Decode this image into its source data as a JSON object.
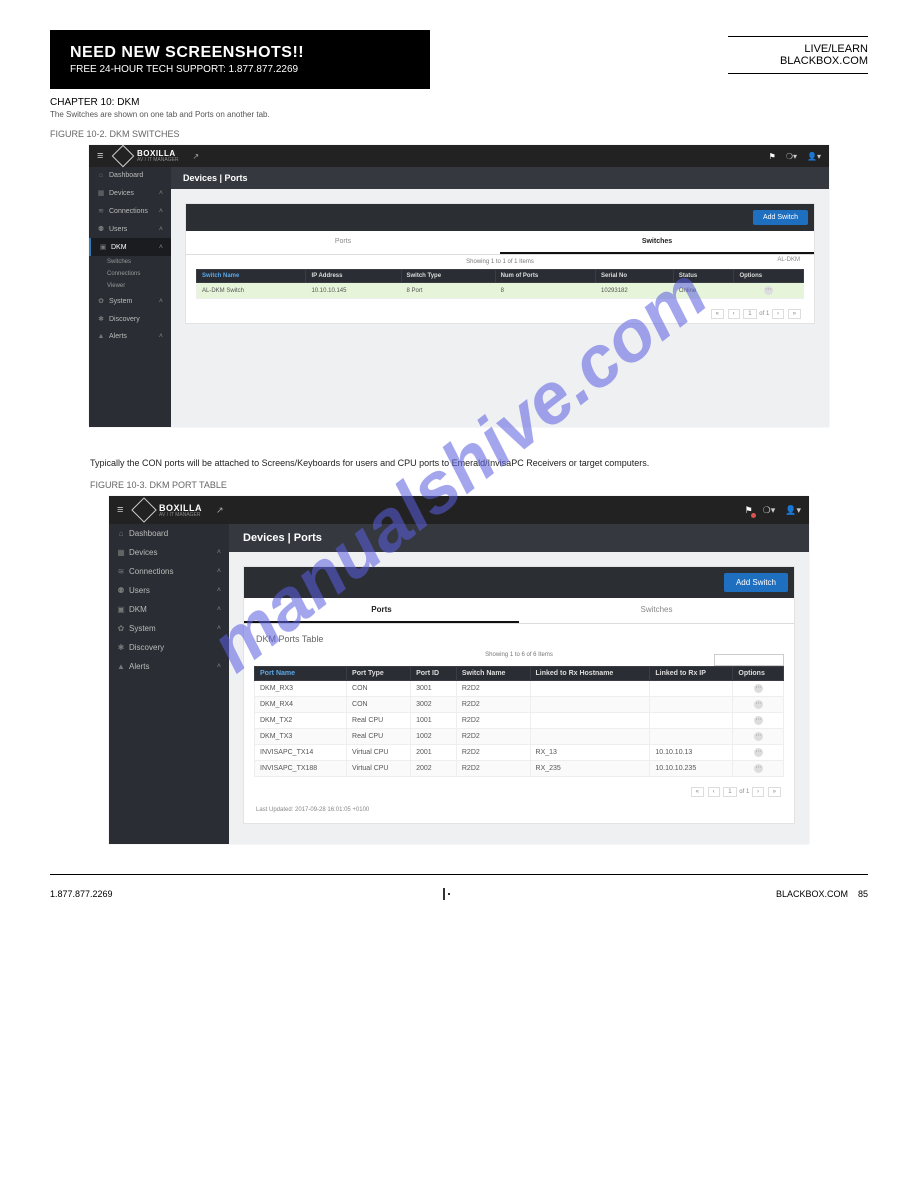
{
  "doc": {
    "header_title": "NEED NEW SCREENSHOTS!!",
    "header_subtitle": "FREE 24-HOUR TECH SUPPORT: 1.877.877.2269",
    "header_right_top": "LIVE/LEARN",
    "header_site": "BLACKBOX.COM",
    "chapter": "CHAPTER 10: DKM",
    "sub1": "The Switches are shown on one tab and Ports on another tab.",
    "figcap1": "FIGURE 10-2. DKM SWITCHES",
    "sub2": "Typically the CON ports will be attached to Screens/Keyboards for users and CPU ports to Emerald/InvisaPC Receivers or target computers.",
    "figcap2": "FIGURE 10-3. DKM PORT TABLE",
    "footer_phone": "1.877.877.2269",
    "footer_site": "BLACKBOX.COM",
    "page_no": "85",
    "watermark": "manualshive.com"
  },
  "app": {
    "brand": "BOXILLA",
    "brand_sub": "AV / IT MANAGER",
    "page_title": "Devices | Ports",
    "add_switch": "Add Switch",
    "tabs": {
      "ports": "Ports",
      "switches": "Switches"
    },
    "showing1": "Showing 1 to 1 of 1 Items",
    "swlabel": "AL-DKM",
    "nav": [
      {
        "icon": "⌂",
        "label": "Dashboard",
        "expand": false
      },
      {
        "icon": "▦",
        "label": "Devices",
        "expand": true
      },
      {
        "icon": "≋",
        "label": "Connections",
        "expand": true
      },
      {
        "icon": "⚉",
        "label": "Users",
        "expand": true
      },
      {
        "icon": "▣",
        "label": "DKM",
        "expand": true,
        "active": true,
        "sub": [
          "Switches",
          "Connections",
          "Viewer"
        ]
      },
      {
        "icon": "✿",
        "label": "System",
        "expand": true
      },
      {
        "icon": "✱",
        "label": "Discovery",
        "expand": false
      },
      {
        "icon": "▲",
        "label": "Alerts",
        "expand": true
      }
    ],
    "switch_cols": [
      "Switch Name",
      "IP Address",
      "Switch Type",
      "Num of Ports",
      "Serial No",
      "Status",
      "Options"
    ],
    "switch_rows": [
      {
        "name": "AL-DKM Switch",
        "ip": "10.10.10.145",
        "type": "8 Port",
        "ports": "8",
        "serial": "10293182",
        "status": "Online"
      }
    ],
    "pager": {
      "page": "1",
      "of": "of 1"
    },
    "ports_title": "DKM Ports Table",
    "showing2": "Showing 1 to 6 of 6 Items",
    "port_cols": [
      "Port Name",
      "Port Type",
      "Port ID",
      "Switch Name",
      "Linked to Rx Hostname",
      "Linked to Rx IP",
      "Options"
    ],
    "port_rows": [
      {
        "n": "DKM_RX3",
        "t": "CON",
        "id": "3001",
        "s": "R2D2",
        "h": "",
        "ip": ""
      },
      {
        "n": "DKM_RX4",
        "t": "CON",
        "id": "3002",
        "s": "R2D2",
        "h": "",
        "ip": ""
      },
      {
        "n": "DKM_TX2",
        "t": "Real CPU",
        "id": "1001",
        "s": "R2D2",
        "h": "",
        "ip": ""
      },
      {
        "n": "DKM_TX3",
        "t": "Real CPU",
        "id": "1002",
        "s": "R2D2",
        "h": "",
        "ip": ""
      },
      {
        "n": "INVISAPC_TX14",
        "t": "Virtual CPU",
        "id": "2001",
        "s": "R2D2",
        "h": "RX_13",
        "ip": "10.10.10.13"
      },
      {
        "n": "INVISAPC_TX188",
        "t": "Virtual CPU",
        "id": "2002",
        "s": "R2D2",
        "h": "RX_235",
        "ip": "10.10.10.235"
      }
    ],
    "updated": "Last Updated: 2017-09-28 16:01:05 +0100"
  }
}
